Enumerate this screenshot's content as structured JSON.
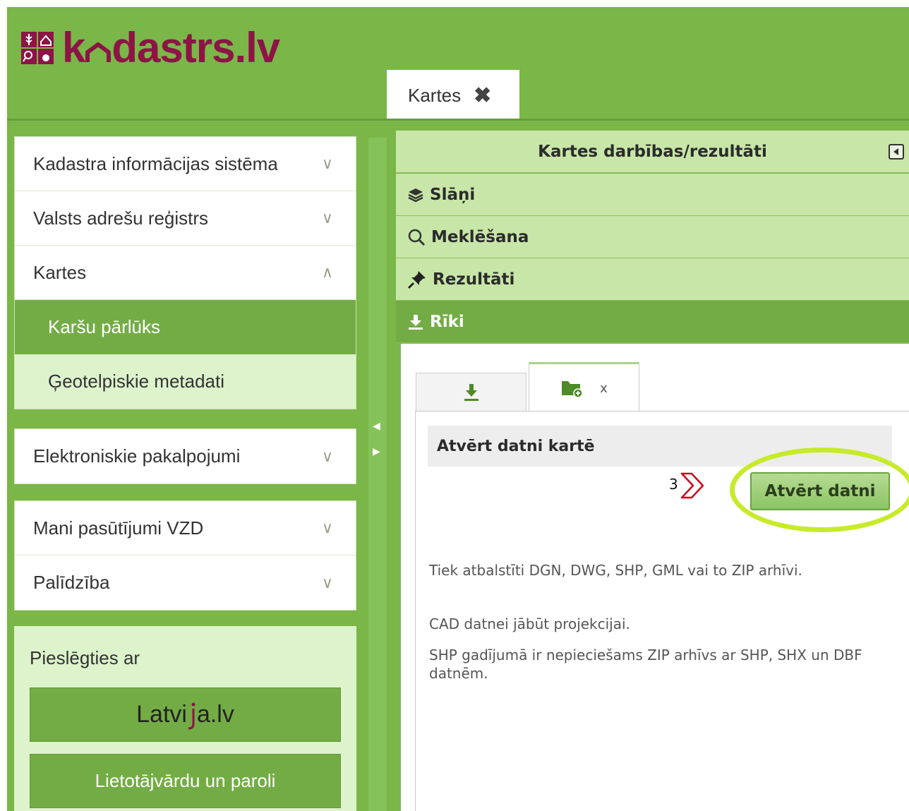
{
  "brand": {
    "logo_text_before": "k",
    "logo_text_after": "dastrs.lv"
  },
  "header": {
    "tab_label": "Kartes",
    "tab_close": "✖"
  },
  "sidebar": {
    "groups": [
      {
        "label": "Kadastra informācijas sistēma",
        "chevron": "∨"
      },
      {
        "label": "Valsts adrešu reģistrs",
        "chevron": "∨"
      },
      {
        "label": "Kartes",
        "chevron": "∧"
      }
    ],
    "kartes_subitems": [
      {
        "label": "Karšu pārlūks",
        "active": true
      },
      {
        "label": "Ģeotelpiskie metadati",
        "active": false
      }
    ],
    "group2": [
      {
        "label": "Elektroniskie pakalpojumi",
        "chevron": "∨"
      }
    ],
    "group3": [
      {
        "label": "Mani pasūtījumi VZD",
        "chevron": "∨"
      },
      {
        "label": "Palīdzība",
        "chevron": "∨"
      }
    ],
    "login": {
      "title": "Pieslēgties ar",
      "latvija_before": "Latvi",
      "latvija_after": "a.lv",
      "password_button": "Lietotājvārdu un paroli"
    }
  },
  "panel": {
    "title": "Kartes darbības/rezultāti",
    "sections": [
      {
        "label": "Slāņi",
        "icon": "layers-icon"
      },
      {
        "label": "Meklēšana",
        "icon": "search-icon"
      },
      {
        "label": "Rezultāti",
        "icon": "pin-icon"
      },
      {
        "label": "Rīki",
        "icon": "download-icon",
        "active": true
      }
    ],
    "tools": {
      "tab_close": "x",
      "section_title": "Atvērt datni kartē",
      "step_number": "3",
      "open_button": "Atvērt datni",
      "descriptions": [
        "Tiek atbalstīti DGN, DWG, SHP, GML vai to ZIP arhīvi.",
        "CAD datnei jābūt projekcijai.",
        "SHP gadījumā ir nepieciešams ZIP arhīvs ar SHP, SHX un DBF datnēm."
      ]
    }
  },
  "colors": {
    "brand_green": "#7ab648",
    "brand_purple": "#8c1446",
    "highlight": "#c7ea2a",
    "step_arrow": "#d0021b"
  }
}
